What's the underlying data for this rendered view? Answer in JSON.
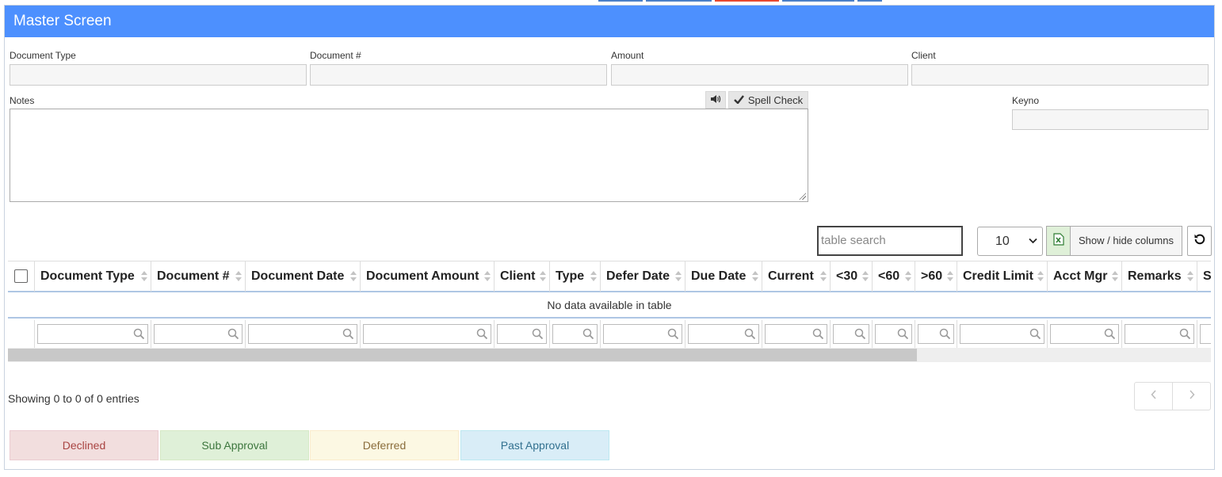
{
  "panel": {
    "title": "Master Screen"
  },
  "form": {
    "document_type_label": "Document Type",
    "document_no_label": "Document #",
    "amount_label": "Amount",
    "client_label": "Client",
    "notes_label": "Notes",
    "keyno_label": "Keyno",
    "spell_check_label": "Spell Check"
  },
  "toolbar": {
    "search_placeholder": "table search",
    "page_length": "10",
    "show_hide_columns_label": "Show / hide columns"
  },
  "table": {
    "columns": [
      "Document Type",
      "Document #",
      "Document Date",
      "Document Amount",
      "Client",
      "Type",
      "Defer Date",
      "Due Date",
      "Current",
      "<30",
      "<60",
      ">60",
      "Credit Limit",
      "Acct Mgr",
      "Remarks",
      "S"
    ],
    "empty_message": "No data available in table"
  },
  "footer": {
    "info": "Showing 0 to 0 of 0 entries"
  },
  "legend": [
    {
      "label": "Declined",
      "bg": "#f2dede",
      "border": "#ebccd1",
      "color": "#a94442"
    },
    {
      "label": "Sub Approval",
      "bg": "#dff0d8",
      "border": "#d6e9c6",
      "color": "#3c763d"
    },
    {
      "label": "Deferred",
      "bg": "#fcf8e3",
      "border": "#faebcc",
      "color": "#8a6d3b"
    },
    {
      "label": "Past Approval",
      "bg": "#d9edf7",
      "border": "#bce8f1",
      "color": "#31708f"
    }
  ],
  "colors": {
    "header_blue": "#4d90fe",
    "row_divider": "#aec6e4",
    "excel_green": "#dff0d8"
  },
  "icons": {
    "speaker": "speaker-icon",
    "spell_check": "check-icon",
    "excel": "excel-icon",
    "refresh": "refresh-icon",
    "filter": "magnifier-icon",
    "sort": "sort-arrows-icon"
  }
}
